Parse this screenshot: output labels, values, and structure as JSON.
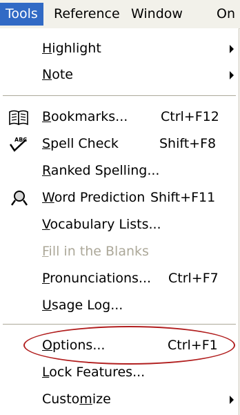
{
  "menubar": {
    "items": [
      {
        "label": "Tools"
      },
      {
        "label": "Reference"
      },
      {
        "label": "Window"
      },
      {
        "label": "On"
      }
    ]
  },
  "tools_menu": {
    "items": [
      {
        "label": "Highlight",
        "mnemonic": "H",
        "has_submenu": true
      },
      {
        "label": "Note",
        "mnemonic": "N",
        "has_submenu": true
      },
      {
        "label": "Bookmarks...",
        "mnemonic": "B",
        "shortcut": "Ctrl+F12",
        "icon": "book-icon"
      },
      {
        "label": "Spell Check",
        "mnemonic": "S",
        "shortcut": "Shift+F8",
        "icon": "spell-check-icon",
        "icon_text": "ABC"
      },
      {
        "label": "Ranked Spelling...",
        "mnemonic": "R"
      },
      {
        "label": "Word Prediction",
        "mnemonic": "W",
        "shortcut": "Shift+F11",
        "icon": "magnifier-icon"
      },
      {
        "label": "Vocabulary Lists...",
        "mnemonic": "V"
      },
      {
        "label": "Fill in the Blanks",
        "mnemonic": "F",
        "disabled": true
      },
      {
        "label": "Pronunciations...",
        "mnemonic": "P",
        "shortcut": "Ctrl+F7"
      },
      {
        "label": "Usage Log...",
        "mnemonic": "U"
      },
      {
        "label": "Options...",
        "mnemonic": "O",
        "shortcut": "Ctrl+F1",
        "annotated": true
      },
      {
        "label": "Lock Features...",
        "mnemonic": "L"
      },
      {
        "label": "Customize",
        "mnemonic": "m",
        "has_submenu": true
      }
    ]
  },
  "annotation": {
    "color": "#b11e1e"
  }
}
